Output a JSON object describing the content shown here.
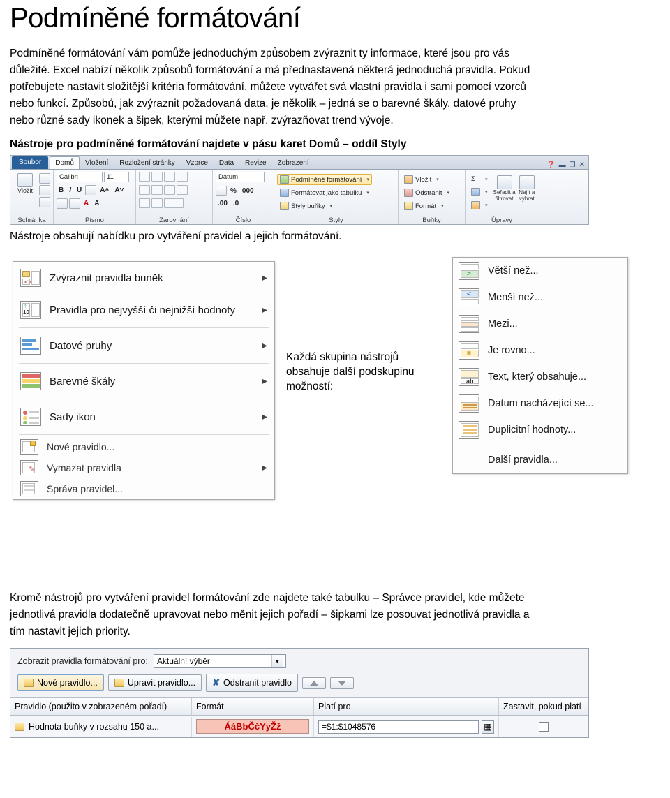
{
  "title": "Podmíněné formátování",
  "intro": [
    "Podmíněné formátování vám pomůže jednoduchým způsobem zvýraznit ty informace, které jsou pro vás",
    "důležité. Excel nabízí několik způsobů formátování a má přednastavená některá jednoduchá pravidla. Pokud",
    "potřebujete nastavit složitější kritéria formátování, můžete vytvářet svá vlastní pravidla i sami pomocí vzorců",
    "nebo funkcí. Způsobů, jak zvýraznit požadovaná data, je několik – jedná se o barevné škály, datové pruhy",
    "nebo různé sady ikonek a šipek, kterými můžete např. zvýrazňovat trend vývoje."
  ],
  "ribbon_caption": "Nástroje pro podmíněné formátování najdete v pásu karet Domů – oddíl Styly",
  "ribbon": {
    "file_tab": "Soubor",
    "tabs": [
      "Domů",
      "Vložení",
      "Rozložení stránky",
      "Vzorce",
      "Data",
      "Revize",
      "Zobrazení"
    ],
    "active_tab": "Domů",
    "groups": [
      {
        "label": "Schránka",
        "name": "clipboard-group"
      },
      {
        "label": "Písmo",
        "name": "font-group"
      },
      {
        "label": "Zarovnání",
        "name": "alignment-group"
      },
      {
        "label": "Číslo",
        "name": "number-group"
      },
      {
        "label": "Styly",
        "name": "styles-group"
      },
      {
        "label": "Buňky",
        "name": "cells-group"
      },
      {
        "label": "Úpravy",
        "name": "editing-group"
      }
    ],
    "clipboard": {
      "paste": "Vložit"
    },
    "font": {
      "name": "Calibri",
      "size": "11",
      "bold": "B",
      "italic": "I",
      "underline": "U"
    },
    "number": {
      "format": "Datum",
      "percent": "%",
      "thousands": "000",
      "inc": ".00",
      "dec": ".0"
    },
    "styles": {
      "conditional": "Podmíněné formátování",
      "as_table": "Formátovat jako tabulku",
      "cell_styles": "Styly buňky"
    },
    "cells": {
      "insert": "Vložit",
      "delete": "Odstranit",
      "format": "Formát"
    },
    "editing": {
      "sum": "Σ",
      "sort": "Seřadit a\nfiltrovat",
      "find": "Najít a\nvybrat"
    }
  },
  "after_ribbon": "Nástroje obsahují nabídku pro vytváření pravidel a jejich formátování.",
  "menu_left": {
    "name": "conditional-formatting-menu",
    "items": [
      {
        "label": "Zvýraznit pravidla buněk",
        "arrow": true,
        "icon": "cells-rules-icon"
      },
      {
        "label": "Pravidla pro nejvyšší či nejnižší hodnoty",
        "arrow": true,
        "icon": "top-bottom-rules-icon"
      },
      {
        "label": "Datové pruhy",
        "arrow": true,
        "icon": "data-bars-icon"
      },
      {
        "label": "Barevné škály",
        "arrow": true,
        "icon": "color-scales-icon"
      },
      {
        "label": "Sady ikon",
        "arrow": true,
        "icon": "icon-sets-icon"
      }
    ],
    "bottom_items": [
      {
        "label": "Nové pravidlo...",
        "arrow": false,
        "icon": "new-rule-icon"
      },
      {
        "label": "Vymazat pravidla",
        "arrow": true,
        "icon": "clear-rules-icon"
      },
      {
        "label": "Správa pravidel...",
        "arrow": false,
        "icon": "manage-rules-icon"
      }
    ]
  },
  "note": "Každá skupina nástrojů obsahuje další podskupinu možností:",
  "menu_right": {
    "name": "highlight-cells-submenu",
    "items": [
      {
        "label": "Větší než...",
        "glyph": ">"
      },
      {
        "label": "Menší než...",
        "glyph": "<"
      },
      {
        "label": "Mezi...",
        "glyph": "↔"
      },
      {
        "label": "Je rovno...",
        "glyph": "="
      },
      {
        "label": "Text, který obsahuje...",
        "glyph": "ab"
      },
      {
        "label": "Datum nacházející se...",
        "glyph": "date"
      },
      {
        "label": "Duplicitní hodnoty...",
        "glyph": "dup"
      }
    ],
    "more": "Další pravidla..."
  },
  "bottom_text": [
    "Kromě nástrojů pro vytváření pravidel formátování zde najdete také tabulku – Správce pravidel, kde můžete",
    "jednotlivá pravidla dodatečně upravovat nebo měnit jejich pořadí – šipkami lze posouvat jednotlivá pravidla a",
    "tím nastavit jejich priority."
  ],
  "rules_manager": {
    "show_label": "Zobrazit pravidla formátování pro:",
    "show_value": "Aktuální výběr",
    "buttons": {
      "new": "Nové pravidlo...",
      "edit": "Upravit pravidlo...",
      "delete": "Odstranit pravidlo",
      "up": "▲",
      "down": "▼"
    },
    "columns": [
      "Pravidlo (použito v zobrazeném pořadí)",
      "Formát",
      "Platí pro",
      "Zastavit, pokud platí"
    ],
    "rows": [
      {
        "rule": "Hodnota buňky v rozsahu 150 a...",
        "format": "ÁáBbČčYyŽž",
        "applies_to": "=$1:$1048576",
        "stop": false
      }
    ]
  }
}
